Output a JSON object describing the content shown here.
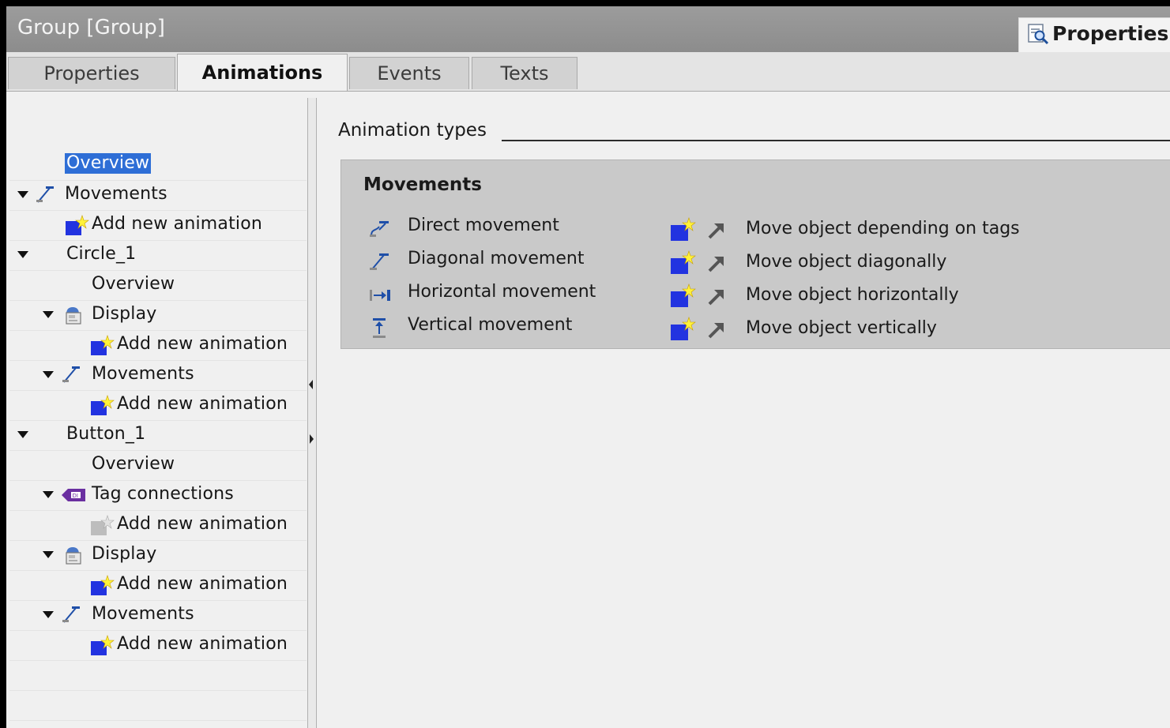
{
  "window": {
    "title": "Group [Group]",
    "properties_button": "Properties"
  },
  "tabs": [
    {
      "label": "Properties",
      "active": false
    },
    {
      "label": "Animations",
      "active": true
    },
    {
      "label": "Events",
      "active": false
    },
    {
      "label": "Texts",
      "active": false
    }
  ],
  "tree": {
    "items": [
      {
        "label": "Overview",
        "selected": true
      },
      {
        "label": "Movements",
        "icon": "diagonal-movement-icon"
      },
      {
        "label": "Add new animation",
        "icon": "add-animation-icon"
      },
      {
        "label": "Circle_1"
      },
      {
        "label": "Overview"
      },
      {
        "label": "Display",
        "icon": "display-icon"
      },
      {
        "label": "Add new animation",
        "icon": "add-animation-icon"
      },
      {
        "label": "Movements",
        "icon": "diagonal-movement-icon"
      },
      {
        "label": "Add new animation",
        "icon": "add-animation-icon"
      },
      {
        "label": "Button_1"
      },
      {
        "label": "Overview"
      },
      {
        "label": "Tag connections",
        "icon": "tag-connection-icon"
      },
      {
        "label": "Add new animation",
        "icon": "add-animation-disabled-icon"
      },
      {
        "label": "Display",
        "icon": "display-icon"
      },
      {
        "label": "Add new animation",
        "icon": "add-animation-icon"
      },
      {
        "label": "Movements",
        "icon": "diagonal-movement-icon"
      },
      {
        "label": "Add new animation",
        "icon": "add-animation-icon"
      }
    ]
  },
  "content": {
    "section_title": "Animation types",
    "panel_title": "Movements",
    "movement_types": [
      {
        "label": "Direct movement",
        "icon": "direct-movement-icon"
      },
      {
        "label": "Diagonal movement",
        "icon": "diagonal-movement-icon"
      },
      {
        "label": "Horizontal movement",
        "icon": "horizontal-movement-icon"
      },
      {
        "label": "Vertical movement",
        "icon": "vertical-movement-icon"
      }
    ],
    "actions": [
      {
        "label": "Move object depending on tags"
      },
      {
        "label": "Move object diagonally"
      },
      {
        "label": "Move object horizontally"
      },
      {
        "label": "Move object vertically"
      }
    ]
  },
  "colors": {
    "selection": "#2e6ed6",
    "titlebar": "#959595",
    "panel": "#c9c9c9",
    "add_icon_blue": "#2233e0"
  }
}
